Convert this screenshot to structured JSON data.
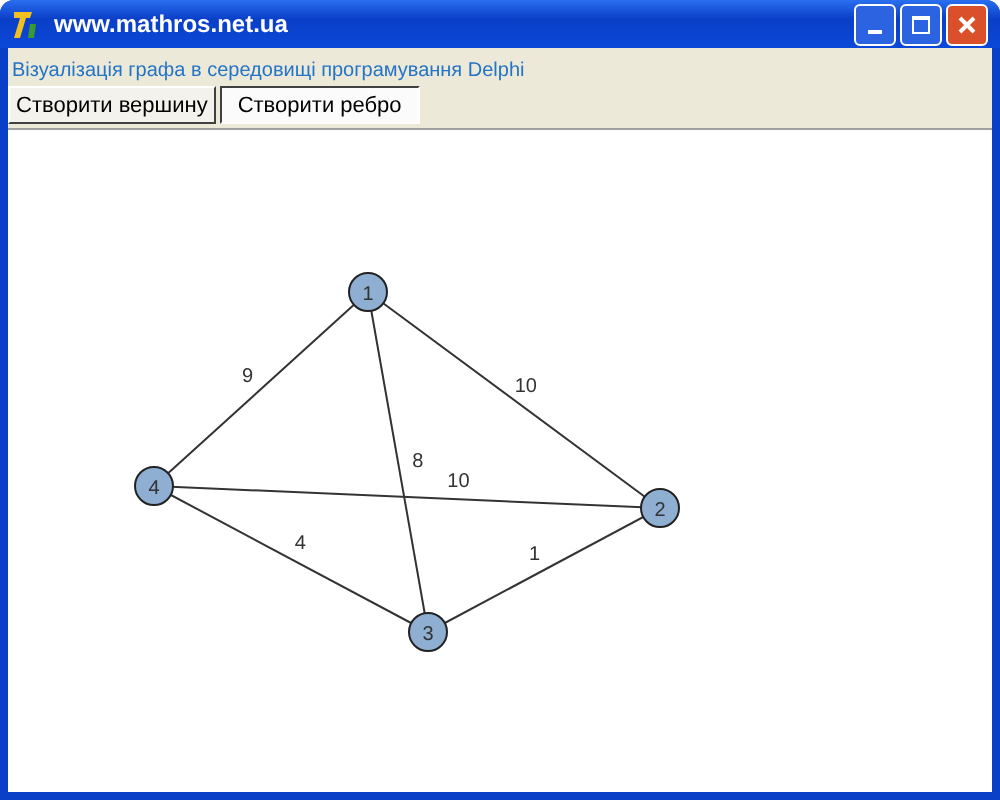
{
  "window": {
    "title": "www.mathros.net.ua"
  },
  "caption": "Візуалізація графа в середовищі програмування Delphi",
  "buttons": [
    {
      "label": "Створити вершину",
      "selected": false
    },
    {
      "label": "Створити ребро",
      "selected": true
    }
  ],
  "graph": {
    "nodes": [
      {
        "label": "1"
      },
      {
        "label": "2"
      },
      {
        "label": "3"
      },
      {
        "label": "4"
      }
    ],
    "edges": [
      {
        "weight": "9"
      },
      {
        "weight": "10"
      },
      {
        "weight": "8"
      },
      {
        "weight": "10"
      },
      {
        "weight": "4"
      },
      {
        "weight": "1"
      }
    ]
  }
}
